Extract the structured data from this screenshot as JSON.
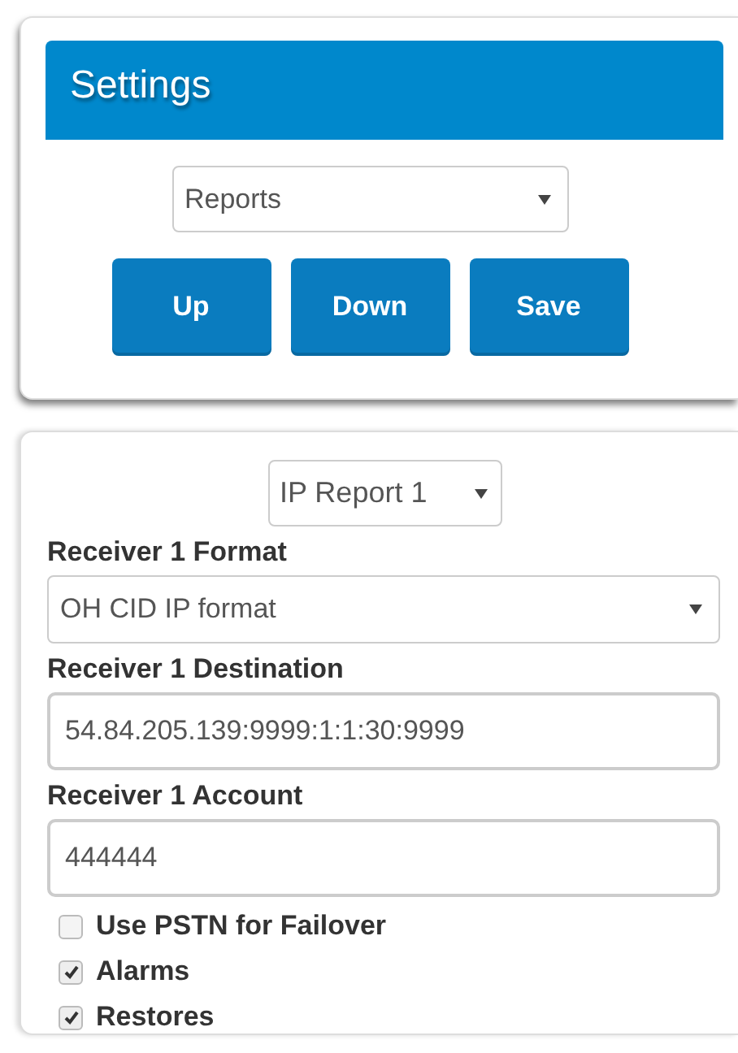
{
  "settings": {
    "title": "Settings",
    "selector": {
      "value": "Reports"
    },
    "buttons": [
      "Up",
      "Down",
      "Save"
    ]
  },
  "report": {
    "selector": {
      "value": "IP Report 1"
    },
    "fields": [
      {
        "kind": "select",
        "label": "Receiver 1 Format",
        "value": "OH CID IP format"
      },
      {
        "kind": "text",
        "label": "Receiver 1 Destination",
        "value": "54.84.205.139:9999:1:1:30:9999"
      },
      {
        "kind": "text",
        "label": "Receiver 1 Account",
        "value": "444444"
      }
    ],
    "options": [
      {
        "label": "Use PSTN for Failover",
        "checked": false
      },
      {
        "label": "Alarms",
        "checked": true
      },
      {
        "label": "Restores",
        "checked": true
      }
    ]
  }
}
